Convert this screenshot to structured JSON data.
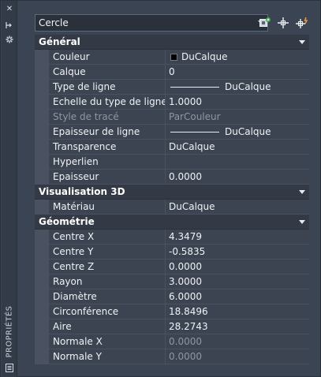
{
  "strip": {
    "title": "PROPRIÉTÉS"
  },
  "selector": {
    "value": "Cercle"
  },
  "toolbar": {
    "icons": [
      "quick-select-icon",
      "select-objects-icon",
      "toggle-pickadd-icon"
    ]
  },
  "categories": {
    "general": {
      "label": "Général",
      "rows": {
        "couleur": {
          "name": "Couleur",
          "value": "DuCalque"
        },
        "calque": {
          "name": "Calque",
          "value": "0"
        },
        "type_ligne": {
          "name": "Type de ligne",
          "value": "DuCalque"
        },
        "echelle": {
          "name": "Echelle du type de ligne",
          "value": "1.0000"
        },
        "style": {
          "name": "Style de tracé",
          "value": "ParCouleur"
        },
        "epaisseur_ligne": {
          "name": "Epaisseur de ligne",
          "value": "DuCalque"
        },
        "transparence": {
          "name": "Transparence",
          "value": "DuCalque"
        },
        "hyperlien": {
          "name": "Hyperlien",
          "value": ""
        },
        "epaisseur": {
          "name": "Epaisseur",
          "value": "0.0000"
        }
      }
    },
    "visu3d": {
      "label": "Visualisation 3D",
      "rows": {
        "materiau": {
          "name": "Matériau",
          "value": "DuCalque"
        }
      }
    },
    "geometrie": {
      "label": "Géométrie",
      "rows": {
        "centre_x": {
          "name": "Centre X",
          "value": "4.3479"
        },
        "centre_y": {
          "name": "Centre Y",
          "value": "-0.5835"
        },
        "centre_z": {
          "name": "Centre Z",
          "value": "0.0000"
        },
        "rayon": {
          "name": "Rayon",
          "value": "3.0000"
        },
        "diametre": {
          "name": "Diamètre",
          "value": "6.0000"
        },
        "circonference": {
          "name": "Circonférence",
          "value": "18.8496"
        },
        "aire": {
          "name": "Aire",
          "value": "28.2743"
        },
        "normale_x": {
          "name": "Normale X",
          "value": "0.0000"
        },
        "normale_y": {
          "name": "Normale Y",
          "value": "0.0000"
        }
      }
    }
  },
  "colors": {
    "panel": "#3b4453",
    "category": "#333a46",
    "cell": "#3c4452",
    "readonly_text": "#8e96a3"
  }
}
